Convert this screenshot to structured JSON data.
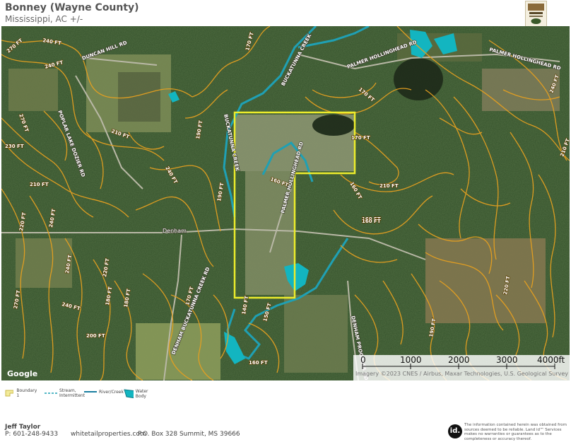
{
  "header": {
    "title": "Bonney (Wayne County)",
    "subtitle": "Mississippi,  AC +/-"
  },
  "map": {
    "roads": [
      {
        "label": "DUNCAN HILL RD"
      },
      {
        "label": "POPLAR LAKE DOZIER RD"
      },
      {
        "label": "BUCKATUNNA CREEK"
      },
      {
        "label": "PALMER HOLLINGHEAD RD"
      },
      {
        "label": "PALMER HOLLINGHEAD RD"
      },
      {
        "label": "PALMER HOLLINGHEAD RD"
      },
      {
        "label": "DENHAM BUCKATUNNA CREEK RD"
      },
      {
        "label": "DENHAM PROGRESS RD"
      },
      {
        "label": "BUCKATUNNA CREEK"
      },
      {
        "label": "Denham"
      },
      {
        "label": "Google"
      }
    ],
    "contour_labels": [
      "270 FT",
      "240 FT",
      "240 FT",
      "170 FT",
      "170 FT",
      "240 FT",
      "270 FT",
      "210 FT",
      "230 FT",
      "240 FT",
      "210 FT",
      "190 FT",
      "210 FT",
      "170 FT",
      "160 FT",
      "160 FT",
      "160 FT",
      "220 FT",
      "240 FT",
      "220 FT",
      "240 FT",
      "270 FT",
      "240 FT",
      "200 FT",
      "180 FT",
      "190 FT",
      "160 FT",
      "160 FT",
      "170 FT",
      "180 FT",
      "220 FT",
      "210 FT",
      "190 FT",
      "150 FT",
      "140 FT"
    ],
    "colors": {
      "contour": "#e6a020",
      "boundary": "#ecec2c",
      "river": "#1fa0b4",
      "water_body": "#13b5c0"
    }
  },
  "scale_bar": {
    "ticks": [
      "0",
      "1000",
      "2000",
      "3000",
      "4000ft"
    ],
    "attribution": "Imagery ©2023 CNES / Airbus, Maxar Technologies, U.S. Geological Survey"
  },
  "legend": {
    "items": [
      {
        "icon": "boundary-icon",
        "label": "Boundary 1"
      },
      {
        "icon": "stream-intermittent-icon",
        "label": "Stream, Intermittent"
      },
      {
        "icon": "river-creek-icon",
        "label": "River/Creek"
      },
      {
        "icon": "water-body-icon",
        "label": "Water Body"
      }
    ]
  },
  "footer": {
    "name": "Jeff Taylor",
    "phone": "P: 601-248-9433",
    "website": "whitetailproperties.com",
    "address": "P.O. Box 328 Summit, MS 39666",
    "badge": "id.",
    "disclaimer": "The information contained herein was obtained from sources deemed to be reliable. Land id™ Services makes no warranties or guarantees as to the completeness or accuracy thereof."
  }
}
